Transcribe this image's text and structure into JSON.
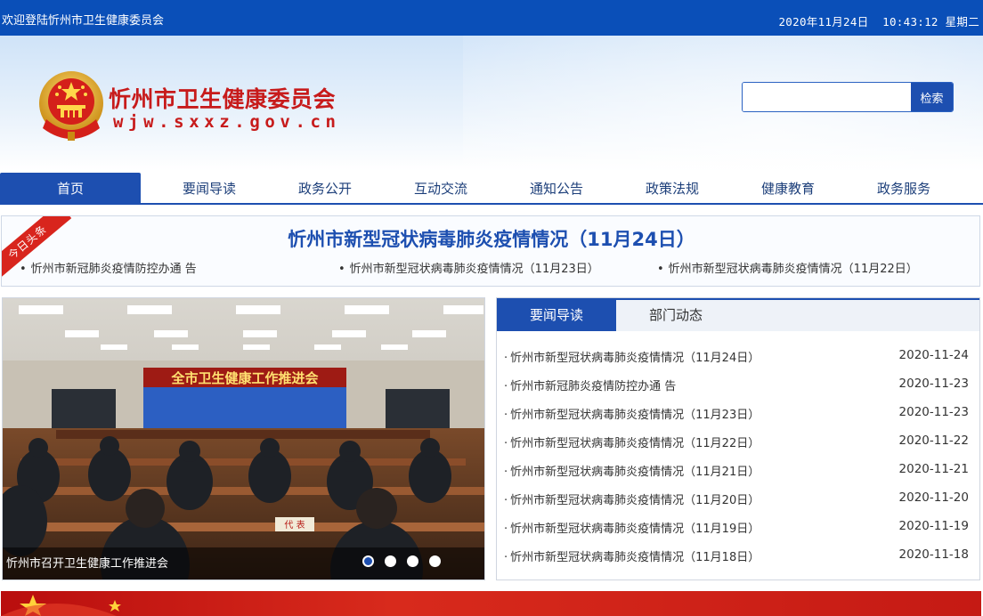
{
  "topbar": {
    "welcome": "欢迎登陆忻州市卫生健康委员会",
    "date": "2020年11月24日",
    "time": "10:43:12",
    "weekday": "星期二"
  },
  "header": {
    "title": "忻州市卫生健康委员会",
    "url": "wjw.sxxz.gov.cn",
    "emblem_icon": "national-emblem-icon"
  },
  "search": {
    "placeholder": "",
    "value": "",
    "button_label": "检索"
  },
  "nav": {
    "items": [
      {
        "label": "首页",
        "active": true
      },
      {
        "label": "要闻导读"
      },
      {
        "label": "政务公开"
      },
      {
        "label": "互动交流"
      },
      {
        "label": "通知公告"
      },
      {
        "label": "政策法规"
      },
      {
        "label": "健康教育"
      },
      {
        "label": "政务服务"
      }
    ]
  },
  "headline": {
    "ribbon": "今日头条",
    "title": "忻州市新型冠状病毒肺炎疫情情况（11月24日）",
    "links": [
      "忻州市新冠肺炎疫情防控办通 告",
      "忻州市新型冠状病毒肺炎疫情情况（11月23日）",
      "忻州市新型冠状病毒肺炎疫情情况（11月22日）"
    ]
  },
  "slider": {
    "caption": "忻州市召开卫生健康工作推进会",
    "screen_text": "全市卫生健康工作推进会",
    "placard_text": "代 表",
    "slides": 4,
    "active_slide": 1
  },
  "news": {
    "tabs": [
      {
        "label": "要闻导读",
        "active": true
      },
      {
        "label": "部门动态"
      }
    ],
    "items": [
      {
        "title": "忻州市新型冠状病毒肺炎疫情情况（11月24日）",
        "date": "2020-11-24"
      },
      {
        "title": "忻州市新冠肺炎疫情防控办通 告",
        "date": "2020-11-23"
      },
      {
        "title": "忻州市新型冠状病毒肺炎疫情情况（11月23日）",
        "date": "2020-11-23"
      },
      {
        "title": "忻州市新型冠状病毒肺炎疫情情况（11月22日）",
        "date": "2020-11-22"
      },
      {
        "title": "忻州市新型冠状病毒肺炎疫情情况（11月21日）",
        "date": "2020-11-21"
      },
      {
        "title": "忻州市新型冠状病毒肺炎疫情情况（11月20日）",
        "date": "2020-11-20"
      },
      {
        "title": "忻州市新型冠状病毒肺炎疫情情况（11月19日）",
        "date": "2020-11-19"
      },
      {
        "title": "忻州市新型冠状病毒肺炎疫情情况（11月18日）",
        "date": "2020-11-18"
      }
    ]
  },
  "colors": {
    "brand_blue": "#1d4fb0",
    "topbar_blue": "#0a4fb8",
    "title_red": "#c71b1b",
    "ribbon_red": "#d8251d"
  }
}
